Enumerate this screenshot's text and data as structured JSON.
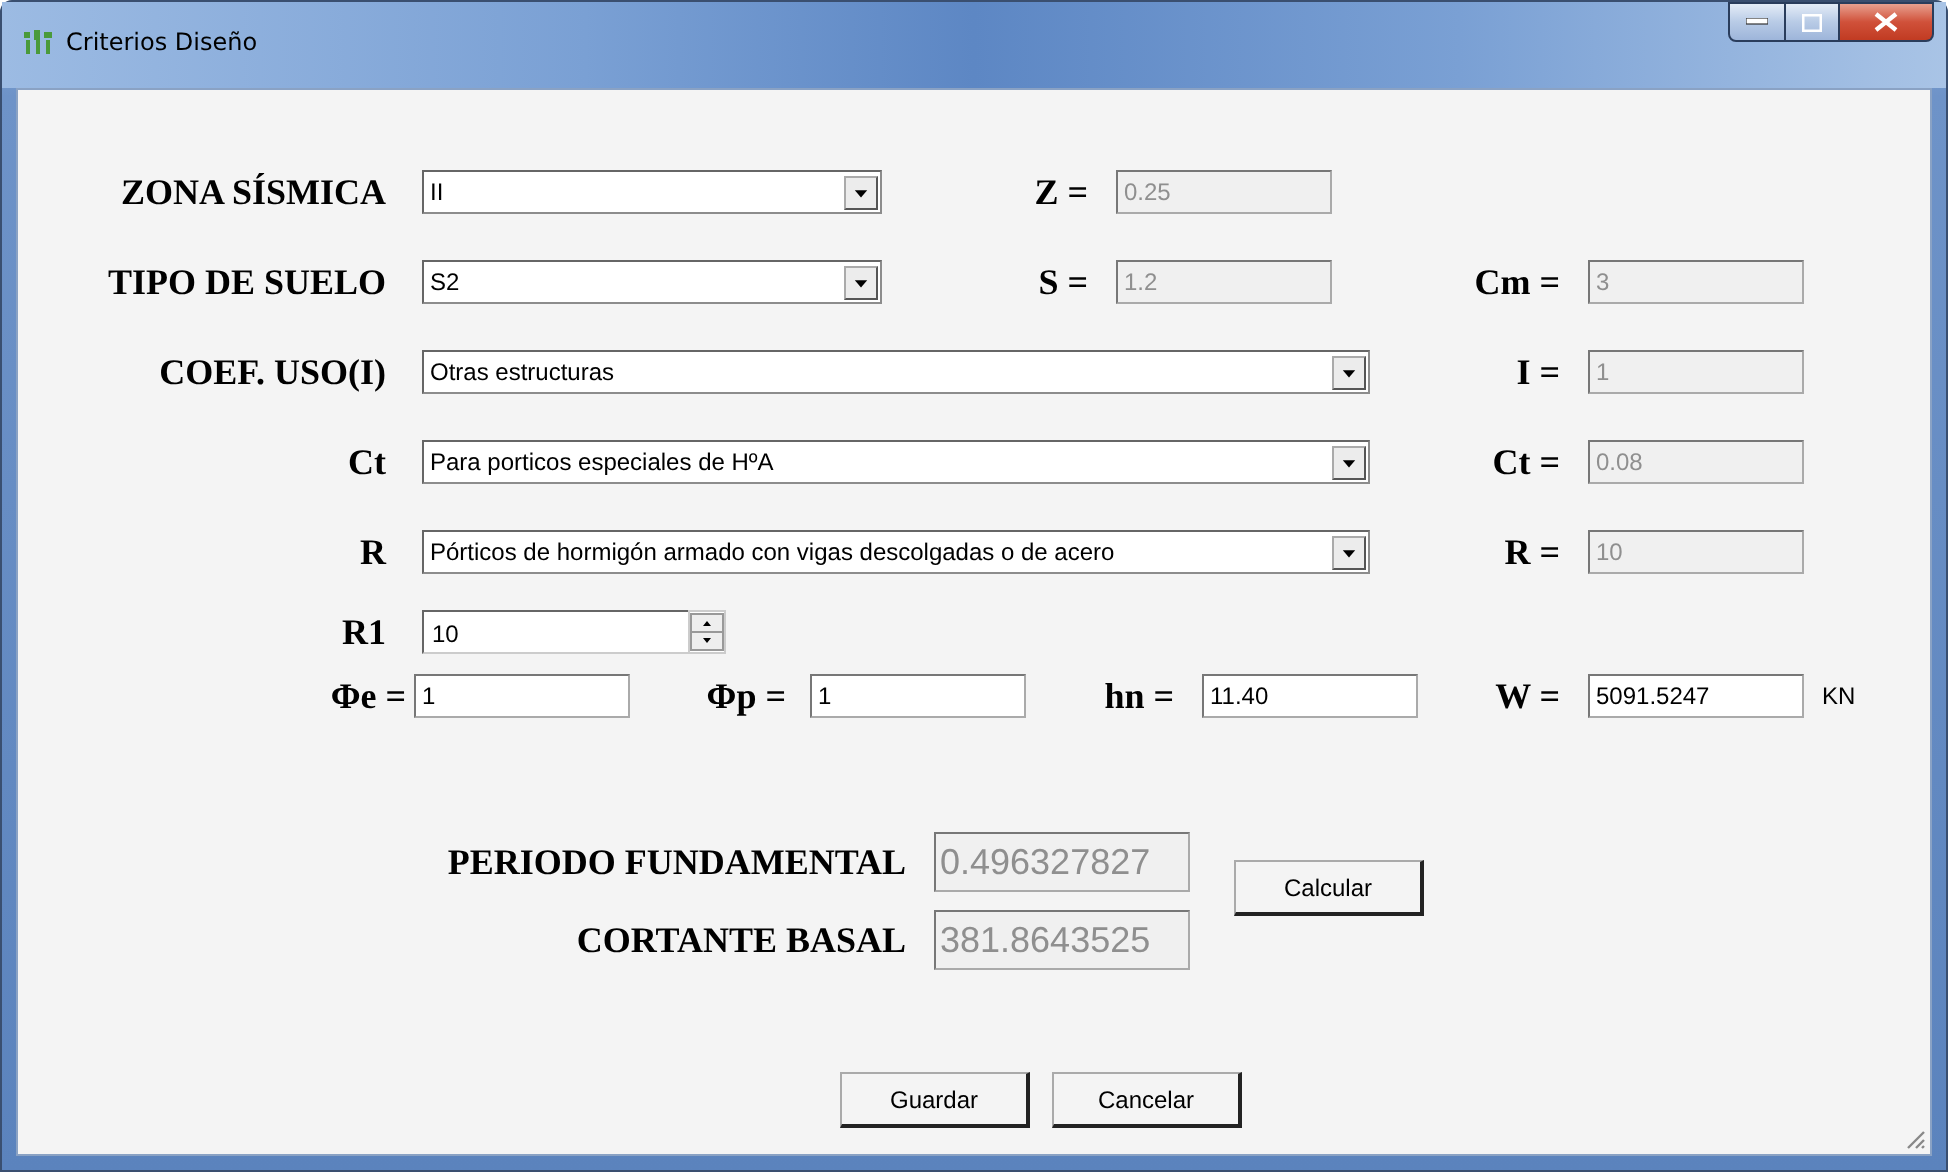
{
  "window": {
    "title": "Criterios Diseño"
  },
  "rows": [
    {
      "label": "ZONA SÍSMICA",
      "kind": "combo",
      "value": "II",
      "readouts": [
        {
          "label": "Z =",
          "value": "0.25",
          "disabled": true
        }
      ]
    },
    {
      "label": "TIPO DE SUELO",
      "kind": "combo",
      "value": "S2",
      "readouts": [
        {
          "label": "S =",
          "value": "1.2",
          "disabled": true
        },
        {
          "label": "Cm =",
          "value": "3",
          "disabled": true
        }
      ]
    },
    {
      "label": "COEF. USO(I)",
      "kind": "combo",
      "value": "Otras estructuras",
      "readouts": [
        {
          "label": "I =",
          "value": "1",
          "disabled": true
        }
      ]
    },
    {
      "label": "Ct",
      "kind": "combo",
      "value": "Para porticos especiales de HºA",
      "readouts": [
        {
          "label": "Ct =",
          "value": "0.08",
          "disabled": true
        }
      ]
    },
    {
      "label": "R",
      "kind": "combo",
      "value": "Pórticos de hormigón armado con vigas descolgadas o de acero",
      "readouts": [
        {
          "label": "R =",
          "value": "10",
          "disabled": true
        }
      ]
    },
    {
      "label": "R1",
      "kind": "spin",
      "value": "10",
      "readouts": []
    }
  ],
  "inputs": [
    {
      "label": "Φe =",
      "value": "1",
      "disabled": false
    },
    {
      "label": "Φp =",
      "value": "1",
      "disabled": false
    },
    {
      "label": "hn =",
      "value": "11.40",
      "disabled": false
    },
    {
      "label": "W =",
      "value": "5091.5247",
      "disabled": false,
      "unit": "KN"
    }
  ],
  "results": [
    {
      "label": "PERIODO FUNDAMENTAL",
      "value": "0.496327827",
      "disabled": true
    },
    {
      "label": "CORTANTE BASAL",
      "value": "381.8643525",
      "disabled": true
    }
  ],
  "calculate_button": "Calcular",
  "buttons": [
    "Guardar",
    "Cancelar"
  ]
}
